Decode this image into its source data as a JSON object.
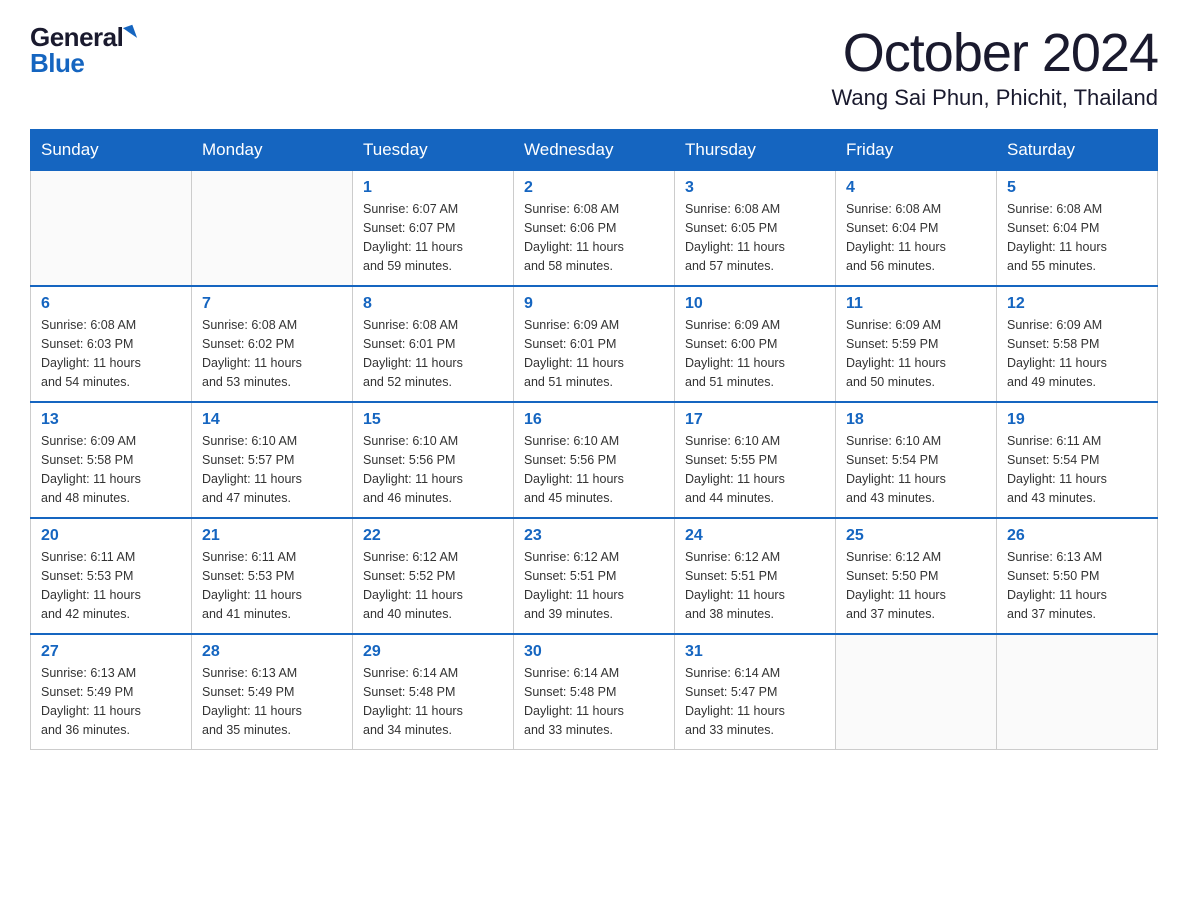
{
  "logo": {
    "general": "General",
    "blue": "Blue"
  },
  "title": "October 2024",
  "subtitle": "Wang Sai Phun, Phichit, Thailand",
  "weekdays": [
    "Sunday",
    "Monday",
    "Tuesday",
    "Wednesday",
    "Thursday",
    "Friday",
    "Saturday"
  ],
  "weeks": [
    [
      {
        "day": "",
        "info": ""
      },
      {
        "day": "",
        "info": ""
      },
      {
        "day": "1",
        "info": "Sunrise: 6:07 AM\nSunset: 6:07 PM\nDaylight: 11 hours\nand 59 minutes."
      },
      {
        "day": "2",
        "info": "Sunrise: 6:08 AM\nSunset: 6:06 PM\nDaylight: 11 hours\nand 58 minutes."
      },
      {
        "day": "3",
        "info": "Sunrise: 6:08 AM\nSunset: 6:05 PM\nDaylight: 11 hours\nand 57 minutes."
      },
      {
        "day": "4",
        "info": "Sunrise: 6:08 AM\nSunset: 6:04 PM\nDaylight: 11 hours\nand 56 minutes."
      },
      {
        "day": "5",
        "info": "Sunrise: 6:08 AM\nSunset: 6:04 PM\nDaylight: 11 hours\nand 55 minutes."
      }
    ],
    [
      {
        "day": "6",
        "info": "Sunrise: 6:08 AM\nSunset: 6:03 PM\nDaylight: 11 hours\nand 54 minutes."
      },
      {
        "day": "7",
        "info": "Sunrise: 6:08 AM\nSunset: 6:02 PM\nDaylight: 11 hours\nand 53 minutes."
      },
      {
        "day": "8",
        "info": "Sunrise: 6:08 AM\nSunset: 6:01 PM\nDaylight: 11 hours\nand 52 minutes."
      },
      {
        "day": "9",
        "info": "Sunrise: 6:09 AM\nSunset: 6:01 PM\nDaylight: 11 hours\nand 51 minutes."
      },
      {
        "day": "10",
        "info": "Sunrise: 6:09 AM\nSunset: 6:00 PM\nDaylight: 11 hours\nand 51 minutes."
      },
      {
        "day": "11",
        "info": "Sunrise: 6:09 AM\nSunset: 5:59 PM\nDaylight: 11 hours\nand 50 minutes."
      },
      {
        "day": "12",
        "info": "Sunrise: 6:09 AM\nSunset: 5:58 PM\nDaylight: 11 hours\nand 49 minutes."
      }
    ],
    [
      {
        "day": "13",
        "info": "Sunrise: 6:09 AM\nSunset: 5:58 PM\nDaylight: 11 hours\nand 48 minutes."
      },
      {
        "day": "14",
        "info": "Sunrise: 6:10 AM\nSunset: 5:57 PM\nDaylight: 11 hours\nand 47 minutes."
      },
      {
        "day": "15",
        "info": "Sunrise: 6:10 AM\nSunset: 5:56 PM\nDaylight: 11 hours\nand 46 minutes."
      },
      {
        "day": "16",
        "info": "Sunrise: 6:10 AM\nSunset: 5:56 PM\nDaylight: 11 hours\nand 45 minutes."
      },
      {
        "day": "17",
        "info": "Sunrise: 6:10 AM\nSunset: 5:55 PM\nDaylight: 11 hours\nand 44 minutes."
      },
      {
        "day": "18",
        "info": "Sunrise: 6:10 AM\nSunset: 5:54 PM\nDaylight: 11 hours\nand 43 minutes."
      },
      {
        "day": "19",
        "info": "Sunrise: 6:11 AM\nSunset: 5:54 PM\nDaylight: 11 hours\nand 43 minutes."
      }
    ],
    [
      {
        "day": "20",
        "info": "Sunrise: 6:11 AM\nSunset: 5:53 PM\nDaylight: 11 hours\nand 42 minutes."
      },
      {
        "day": "21",
        "info": "Sunrise: 6:11 AM\nSunset: 5:53 PM\nDaylight: 11 hours\nand 41 minutes."
      },
      {
        "day": "22",
        "info": "Sunrise: 6:12 AM\nSunset: 5:52 PM\nDaylight: 11 hours\nand 40 minutes."
      },
      {
        "day": "23",
        "info": "Sunrise: 6:12 AM\nSunset: 5:51 PM\nDaylight: 11 hours\nand 39 minutes."
      },
      {
        "day": "24",
        "info": "Sunrise: 6:12 AM\nSunset: 5:51 PM\nDaylight: 11 hours\nand 38 minutes."
      },
      {
        "day": "25",
        "info": "Sunrise: 6:12 AM\nSunset: 5:50 PM\nDaylight: 11 hours\nand 37 minutes."
      },
      {
        "day": "26",
        "info": "Sunrise: 6:13 AM\nSunset: 5:50 PM\nDaylight: 11 hours\nand 37 minutes."
      }
    ],
    [
      {
        "day": "27",
        "info": "Sunrise: 6:13 AM\nSunset: 5:49 PM\nDaylight: 11 hours\nand 36 minutes."
      },
      {
        "day": "28",
        "info": "Sunrise: 6:13 AM\nSunset: 5:49 PM\nDaylight: 11 hours\nand 35 minutes."
      },
      {
        "day": "29",
        "info": "Sunrise: 6:14 AM\nSunset: 5:48 PM\nDaylight: 11 hours\nand 34 minutes."
      },
      {
        "day": "30",
        "info": "Sunrise: 6:14 AM\nSunset: 5:48 PM\nDaylight: 11 hours\nand 33 minutes."
      },
      {
        "day": "31",
        "info": "Sunrise: 6:14 AM\nSunset: 5:47 PM\nDaylight: 11 hours\nand 33 minutes."
      },
      {
        "day": "",
        "info": ""
      },
      {
        "day": "",
        "info": ""
      }
    ]
  ]
}
